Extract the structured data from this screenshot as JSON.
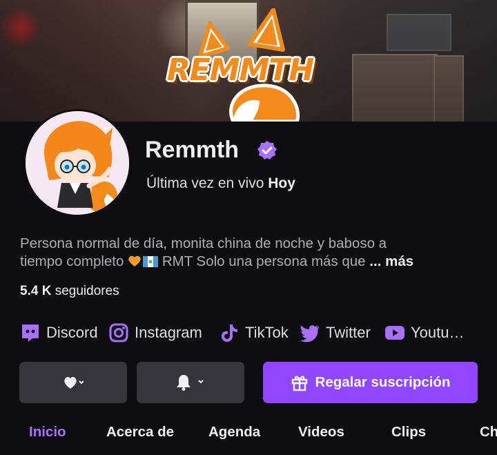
{
  "banner": {
    "logo_text": "REMMTH"
  },
  "channel": {
    "name": "Remmth",
    "last_live_prefix": "Última vez en vivo",
    "last_live_value": "Hoy",
    "bio_line1": "Persona normal de día, monita china de noche y baboso a",
    "bio_line2_start": "tiempo completo",
    "bio_line2_end": "RMT Solo una persona más que",
    "bio_ellipsis": "...",
    "bio_more": "más",
    "followers_count": "5.4 K",
    "followers_label": "seguidores"
  },
  "socials": [
    {
      "label": "Discord",
      "icon": "discord-icon"
    },
    {
      "label": "Instagram",
      "icon": "instagram-icon"
    },
    {
      "label": "TikTok",
      "icon": "tiktok-icon"
    },
    {
      "label": "Twitter",
      "icon": "twitter-icon"
    },
    {
      "label": "Youtu…",
      "icon": "youtube-icon"
    }
  ],
  "actions": {
    "follow_icon": "heart-icon",
    "notify_icon": "bell-icon",
    "gift_label": "Regalar suscripción"
  },
  "tabs": [
    {
      "label": "Inicio",
      "active": true
    },
    {
      "label": "Acerca de",
      "active": false
    },
    {
      "label": "Agenda",
      "active": false
    },
    {
      "label": "Videos",
      "active": false
    },
    {
      "label": "Clips",
      "active": false
    },
    {
      "label": "Ch",
      "active": false
    }
  ],
  "colors": {
    "accent": "#9147ff",
    "accent_text": "#a970ff",
    "background": "#0e0e10",
    "button_grey": "#35353b"
  }
}
